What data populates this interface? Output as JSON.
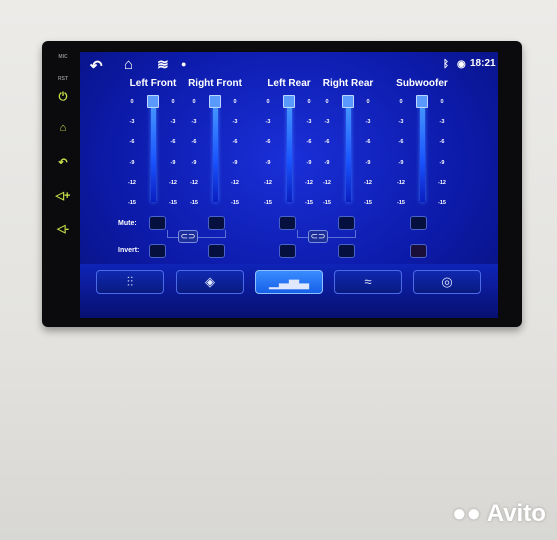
{
  "device_side_buttons": [
    {
      "label": "MIC",
      "icon": ""
    },
    {
      "label": "RST",
      "icon": ""
    },
    {
      "label": "",
      "icon": "power-icon"
    },
    {
      "label": "",
      "icon": "home-icon"
    },
    {
      "label": "",
      "icon": "back-icon"
    },
    {
      "label": "",
      "icon": "volume-up-icon"
    },
    {
      "label": "",
      "icon": "volume-down-icon"
    }
  ],
  "status_bar": {
    "icons": [
      "back-icon",
      "home-icon",
      "layers-icon",
      "location-icon"
    ],
    "right_icons": [
      "bluetooth-icon",
      "location-icon"
    ],
    "time": "18:21"
  },
  "channels": [
    {
      "name": "Left Front",
      "value": 0
    },
    {
      "name": "Right Front",
      "value": 0
    },
    {
      "name": "Left Rear",
      "value": 0
    },
    {
      "name": "Right Rear",
      "value": 0
    },
    {
      "name": "Subwoofer",
      "value": 0
    }
  ],
  "scale_ticks": [
    "0",
    "-3",
    "-6",
    "-9",
    "-12",
    "-15"
  ],
  "rows": {
    "mute": "Mute:",
    "invert": "Invert:"
  },
  "bottom_tabs": [
    {
      "icon": "sliders-icon",
      "active": false
    },
    {
      "icon": "target-icon",
      "active": false
    },
    {
      "icon": "equalizer-bars-icon",
      "active": true
    },
    {
      "icon": "waves-icon",
      "active": false
    },
    {
      "icon": "gauge-icon",
      "active": false
    }
  ],
  "watermark": "Avito",
  "colors": {
    "screen": "#0c1aa8",
    "accent": "#3a8cff",
    "side_icon": "#c9e04a"
  }
}
